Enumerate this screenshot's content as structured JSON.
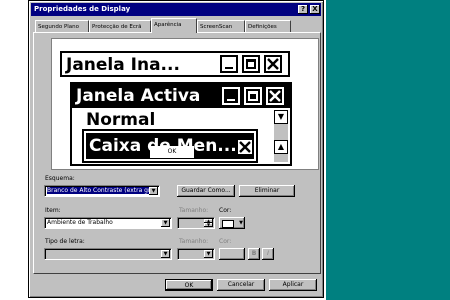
{
  "window": {
    "title": "Propriedades de Display",
    "help_btn": "?",
    "close_btn": "X"
  },
  "tabs": [
    {
      "label": "Segundo Plano"
    },
    {
      "label": "Protecção de Ecrã"
    },
    {
      "label": "Aparência"
    },
    {
      "label": "ScreenScan"
    },
    {
      "label": "Definições"
    }
  ],
  "preview": {
    "inactive_title": "Janela Ina...",
    "active_title": "Janela Activa",
    "normal_text": "Normal",
    "message_title": "Caixa de Men...",
    "ok_label": "OK"
  },
  "scheme": {
    "label": "Esquema:",
    "value": "Branco de Alto Contraste (extra gran",
    "save_label": "Guardar Como...",
    "delete_label": "Eliminar"
  },
  "item": {
    "label": "Item:",
    "value": "Ambiente de Trabalho",
    "size_label": "Tamanho:",
    "color_label": "Cor:"
  },
  "font": {
    "label": "Tipo de letra:",
    "size_label": "Tamanho:",
    "color_label": "Cor:",
    "bold": "B",
    "italic": "I"
  },
  "footer": {
    "ok": "OK",
    "cancel": "Cancelar",
    "apply": "Aplicar"
  },
  "colors": {
    "titlebar": "#000080",
    "desktop": "#008080",
    "face": "#c0c0c0"
  }
}
